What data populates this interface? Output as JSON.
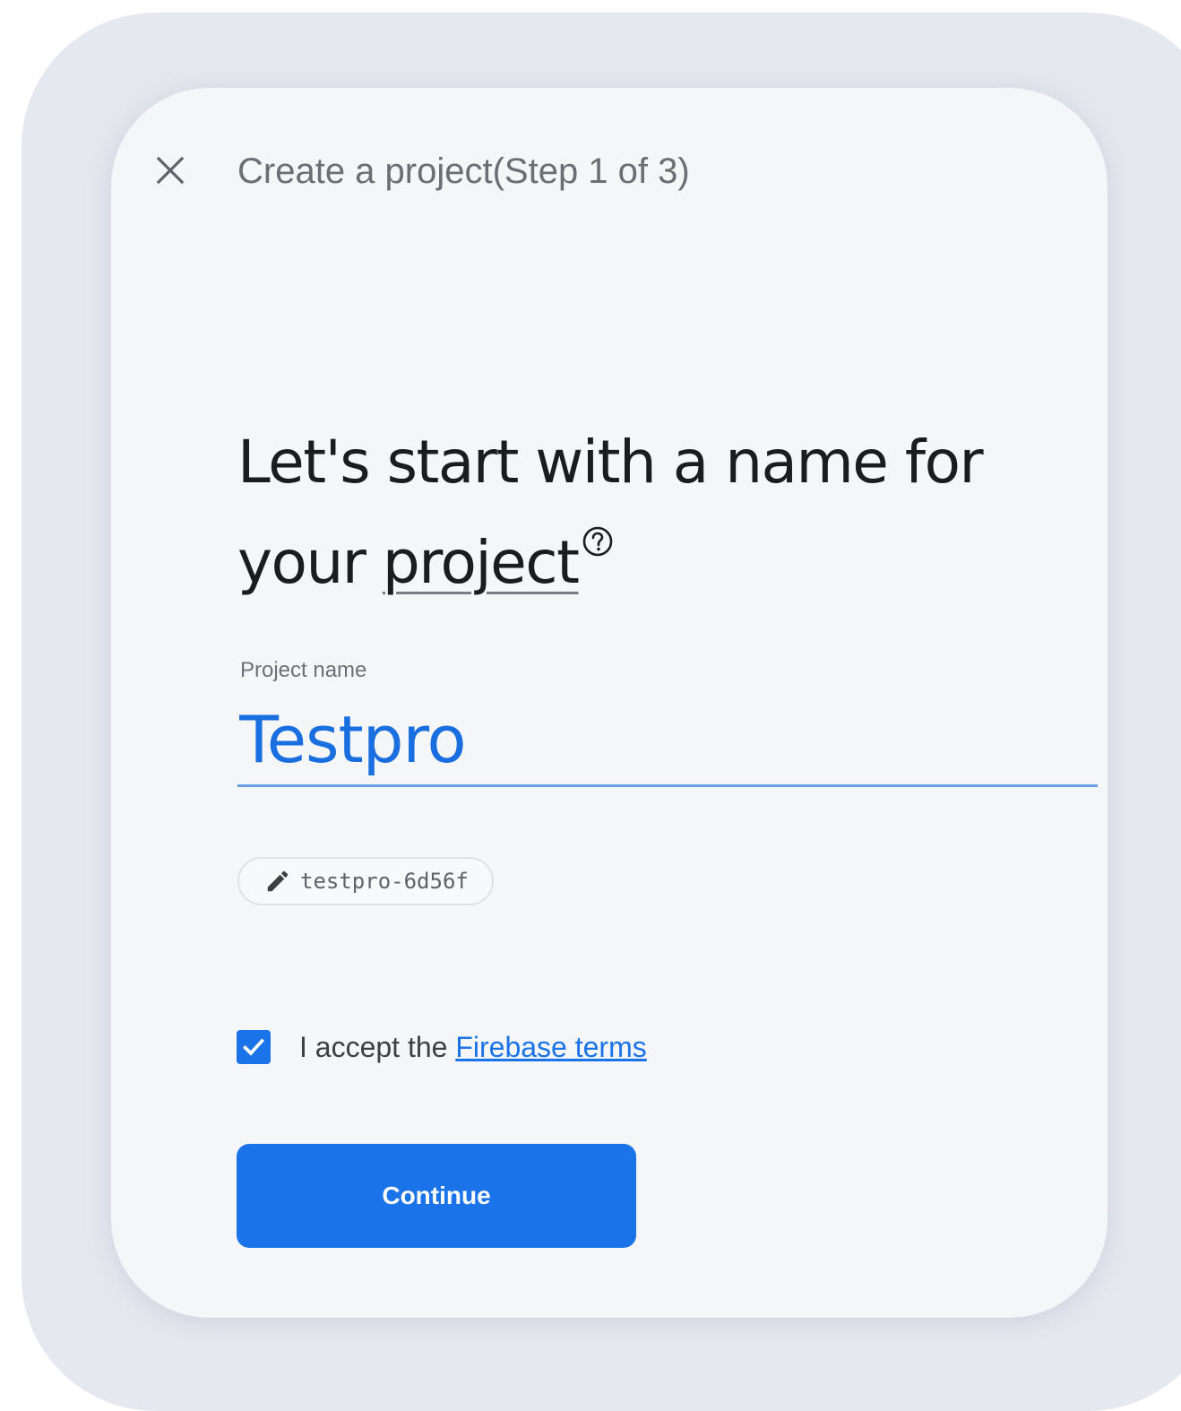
{
  "dialog": {
    "step_title": "Create a project(Step 1 of 3)",
    "close_icon": "close-icon"
  },
  "heading": {
    "text_before": "Let's start with a name for your ",
    "term": "project",
    "help_icon": "help-circle-icon"
  },
  "project_name": {
    "label": "Project name",
    "value": "Testpro"
  },
  "project_id": {
    "edit_icon": "pencil-icon",
    "value": "testpro-6d56f"
  },
  "terms": {
    "checked": true,
    "text": "I accept the ",
    "link_text": "Firebase terms"
  },
  "actions": {
    "continue_label": "Continue"
  },
  "colors": {
    "primary": "#1a73e8",
    "card_background": "#f5f6f8",
    "backdrop": "#e6e8ef",
    "heading_text": "#1b1c1e"
  }
}
